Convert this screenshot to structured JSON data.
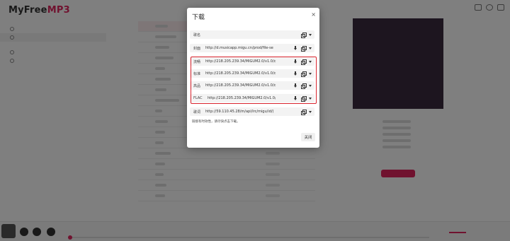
{
  "app": {
    "logo_main": "MyFree",
    "logo_accent": "MP3",
    "accent_color": "#e0245e"
  },
  "dialog": {
    "title": "下载",
    "close_glyph": "×",
    "rows": [
      {
        "label": "歌名",
        "value": "",
        "has_download": false
      },
      {
        "label": "封面",
        "value": "http://d.musicapp.migu.cn/prod/file-se",
        "has_download": true
      },
      {
        "label": "流畅",
        "value": "http://218.205.239.34/MIGUM2.0/v1.0/c",
        "has_download": true
      },
      {
        "label": "标准",
        "value": "http://218.205.239.34/MIGUM2.0/v1.0/c",
        "has_download": true
      },
      {
        "label": "高品",
        "value": "http://218.205.239.34/MIGUM2.0/v1.0/c",
        "has_download": true
      },
      {
        "label": "FLAC",
        "value": "http://218.205.239.34/MIGUM2.0/v1.0/c",
        "has_download": true
      },
      {
        "label": "歌词",
        "value": "http://59.110.45.28/m/api/lrc/migu/id/(",
        "has_download": false
      }
    ],
    "note": "链接有时效性，请尽快点击下载。",
    "close_button": "关闭",
    "highlight_color": "#d9232d"
  },
  "icons": {
    "download": "download-icon",
    "copy": "copy-icon",
    "menu": "chevron-down-icon"
  }
}
